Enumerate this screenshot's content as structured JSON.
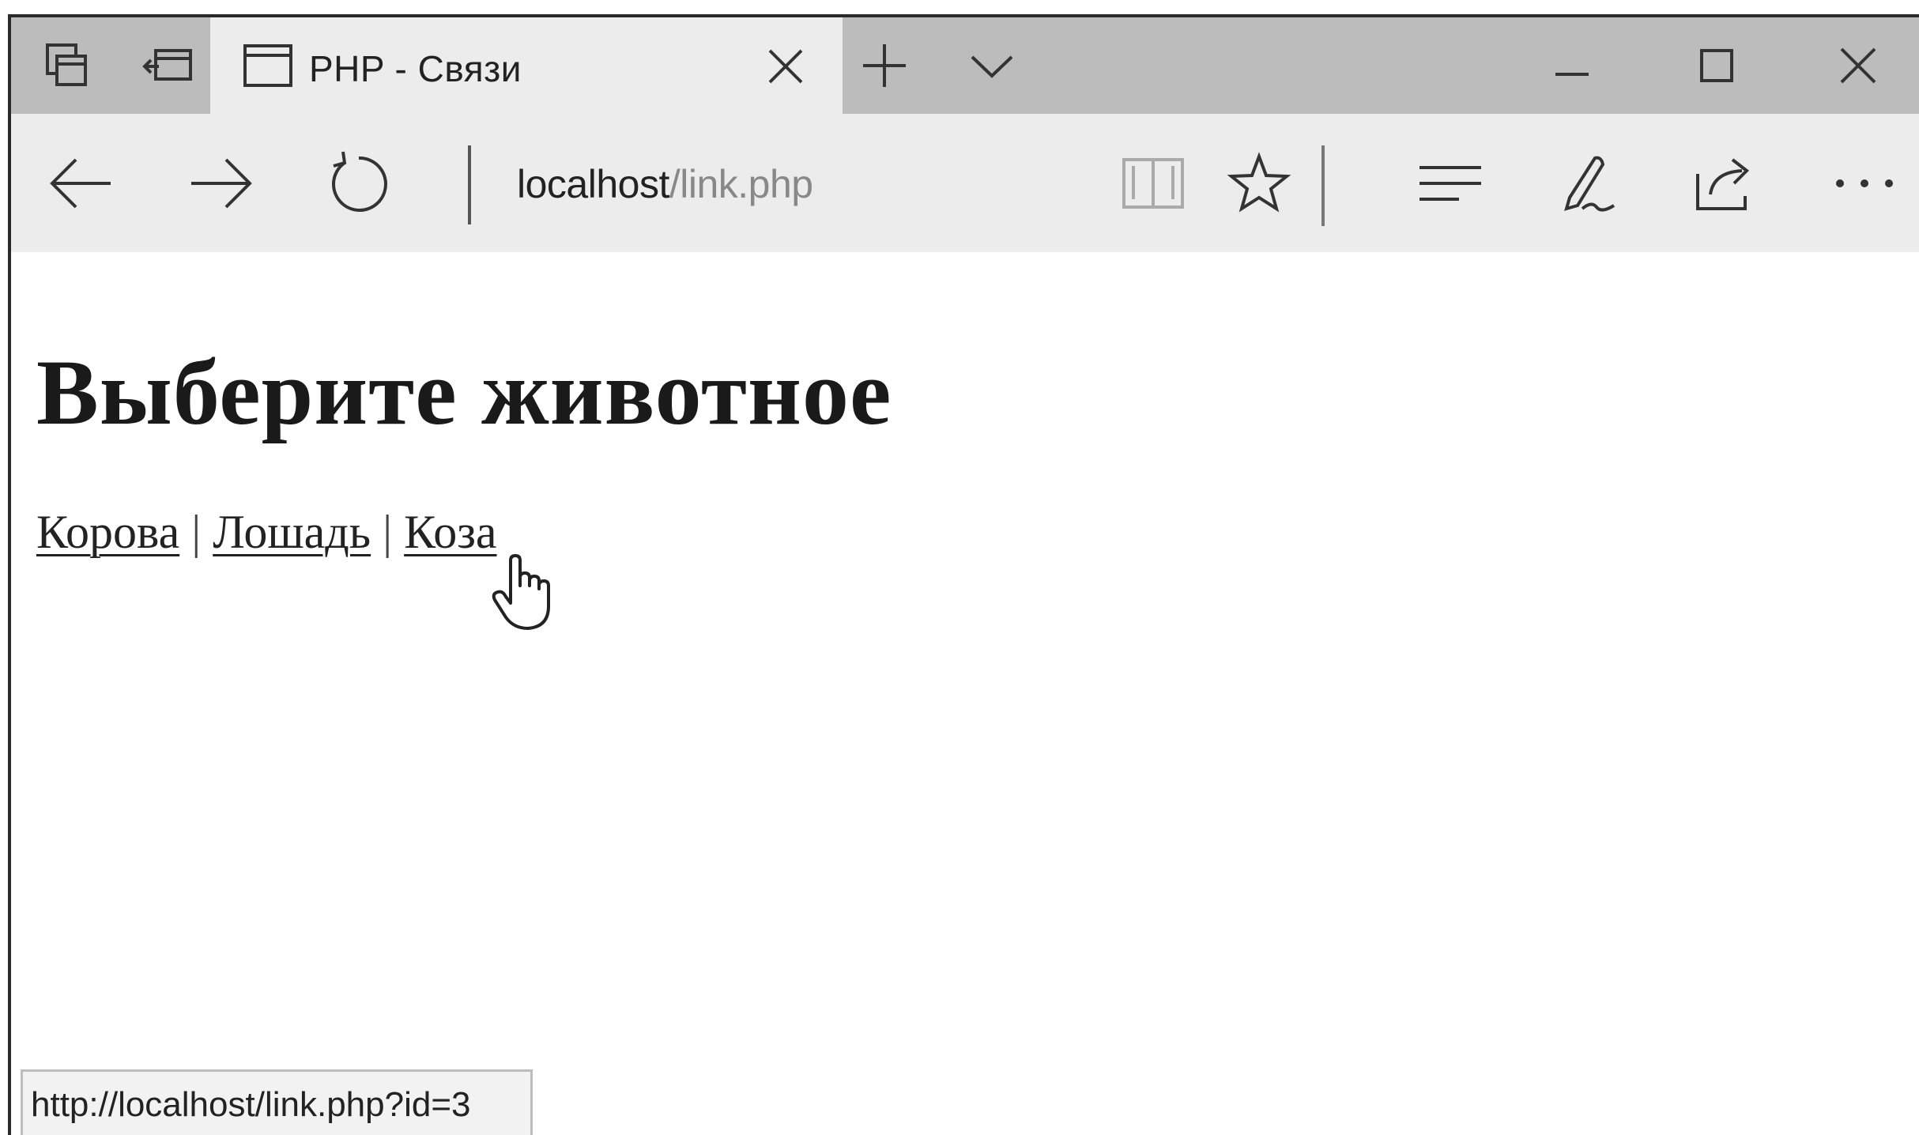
{
  "tab": {
    "title": "PHP - Связи"
  },
  "address": {
    "host": "localhost",
    "path": "/link.php"
  },
  "page": {
    "heading": "Выберите животное",
    "links": [
      "Корова",
      "Лошадь",
      "Коза"
    ],
    "separator": "|"
  },
  "status": {
    "url": "http://localhost/link.php?id=3"
  },
  "icons": {
    "tabbar": [
      "tab-set-aside-icon",
      "tabs-preview-icon",
      "page-icon",
      "close-icon",
      "new-tab-icon",
      "tab-menu-chevron-icon",
      "minimize-icon",
      "maximize-icon",
      "close-window-icon"
    ],
    "navbar": [
      "back-arrow-icon",
      "forward-arrow-icon",
      "refresh-icon",
      "reading-view-icon",
      "favorite-star-icon",
      "hub-icon",
      "web-note-icon",
      "share-icon",
      "more-icon"
    ],
    "content": [
      "hand-pointer-cursor-icon"
    ]
  },
  "colors": {
    "tabbar_bg": "#bcbcbc",
    "active_tab_bg": "#ececec",
    "navbar_bg": "#ececec",
    "text": "#222222"
  }
}
